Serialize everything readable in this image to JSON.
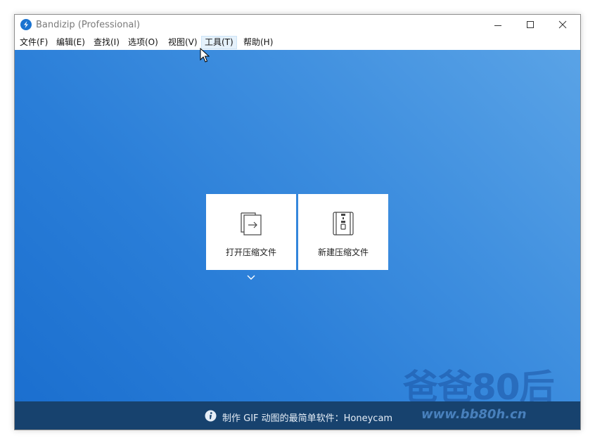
{
  "window": {
    "title": "Bandizip (Professional)"
  },
  "menu": {
    "items": [
      "文件(F)",
      "编辑(E)",
      "查找(I)",
      "选项(O)",
      "视图(V)",
      "工具(T)",
      "帮助(H)"
    ],
    "active_index": 5
  },
  "main": {
    "open_archive_label": "打开压缩文件",
    "new_archive_label": "新建压缩文件"
  },
  "footer": {
    "tip": "制作 GIF 动图的最简单软件：Honeycam"
  },
  "watermark": {
    "title": "爸爸80后",
    "url": "www.bb80h.cn"
  },
  "colors": {
    "accent": "#1a73d0",
    "footer_bg": "#17426e",
    "gradient_top": "#5aa3e6",
    "gradient_bottom": "#1b6fcf"
  }
}
